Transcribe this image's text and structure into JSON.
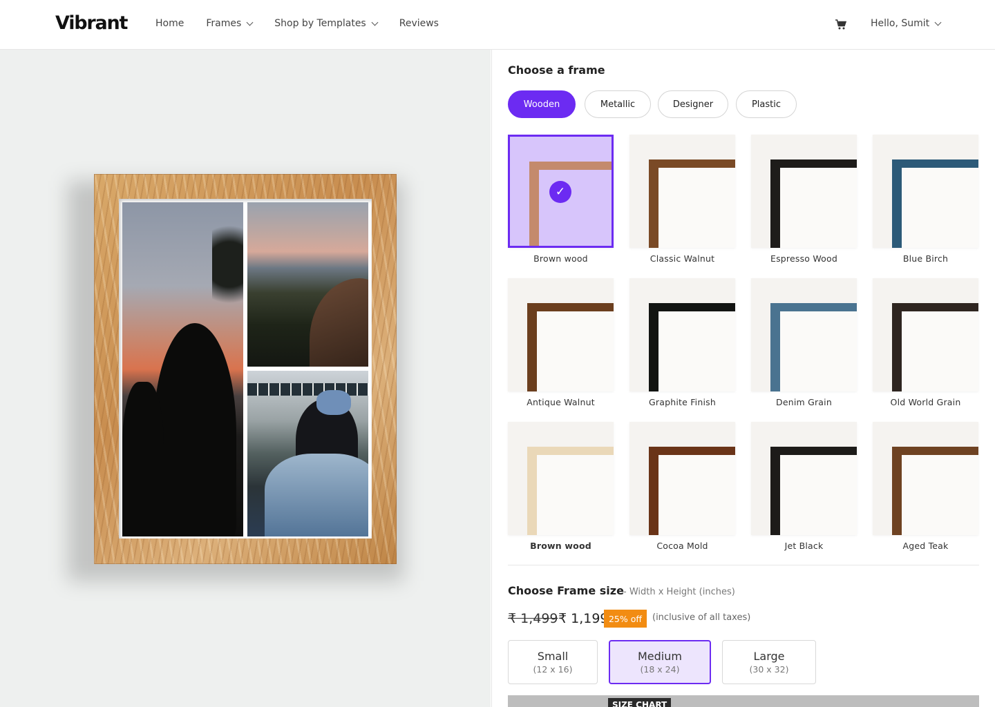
{
  "header": {
    "logo": "Vibrant",
    "nav": [
      {
        "label": "Home",
        "has_dropdown": false
      },
      {
        "label": "Frames",
        "has_dropdown": true
      },
      {
        "label": "Shop by Templates",
        "has_dropdown": true
      },
      {
        "label": "Reviews",
        "has_dropdown": false
      }
    ],
    "cart_icon": "cart-icon",
    "user_greeting": "Hello, Sumit"
  },
  "frame_section": {
    "title": "Choose a frame",
    "tabs": [
      {
        "label": "Wooden",
        "active": true
      },
      {
        "label": "Metallic",
        "active": false
      },
      {
        "label": "Designer",
        "active": false
      },
      {
        "label": "Plastic",
        "active": false
      }
    ],
    "frames": [
      {
        "name": "Brown wood",
        "color": "#c48a6c",
        "selected": true
      },
      {
        "name": "Classic Walnut",
        "color": "#7a4a26"
      },
      {
        "name": "Espresso Wood",
        "color": "#1e1c1a"
      },
      {
        "name": "Blue Birch",
        "color": "#2c5a78"
      },
      {
        "name": "Antique Walnut",
        "color": "#6b3e1e"
      },
      {
        "name": "Graphite Finish",
        "color": "#121412"
      },
      {
        "name": "Denim Grain",
        "color": "#4a7390"
      },
      {
        "name": "Old World Grain",
        "color": "#2e2520"
      },
      {
        "name": "Brown wood",
        "color": "#ead8b8",
        "bold": true
      },
      {
        "name": "Cocoa Mold",
        "color": "#6a3418"
      },
      {
        "name": "Jet Black",
        "color": "#1d1b19"
      },
      {
        "name": "Aged Teak",
        "color": "#6e4222"
      }
    ]
  },
  "size_section": {
    "title": "Choose Frame size",
    "subtitle": "- Width x Height (inches)",
    "price_old": "₹ 1,499",
    "price_new": "₹ 1,199",
    "discount": "25% off",
    "tax_note": "(inclusive of all taxes)",
    "sizes": [
      {
        "name": "Small",
        "dims": "(12 x 16)",
        "active": false
      },
      {
        "name": "Medium",
        "dims": "(18 x 24)",
        "active": true
      },
      {
        "name": "Large",
        "dims": "(30 x 32)",
        "active": false
      }
    ],
    "size_chart_label": "SIZE CHART"
  },
  "colors": {
    "accent": "#6c2bf2",
    "discount_badge": "#f28c12"
  }
}
